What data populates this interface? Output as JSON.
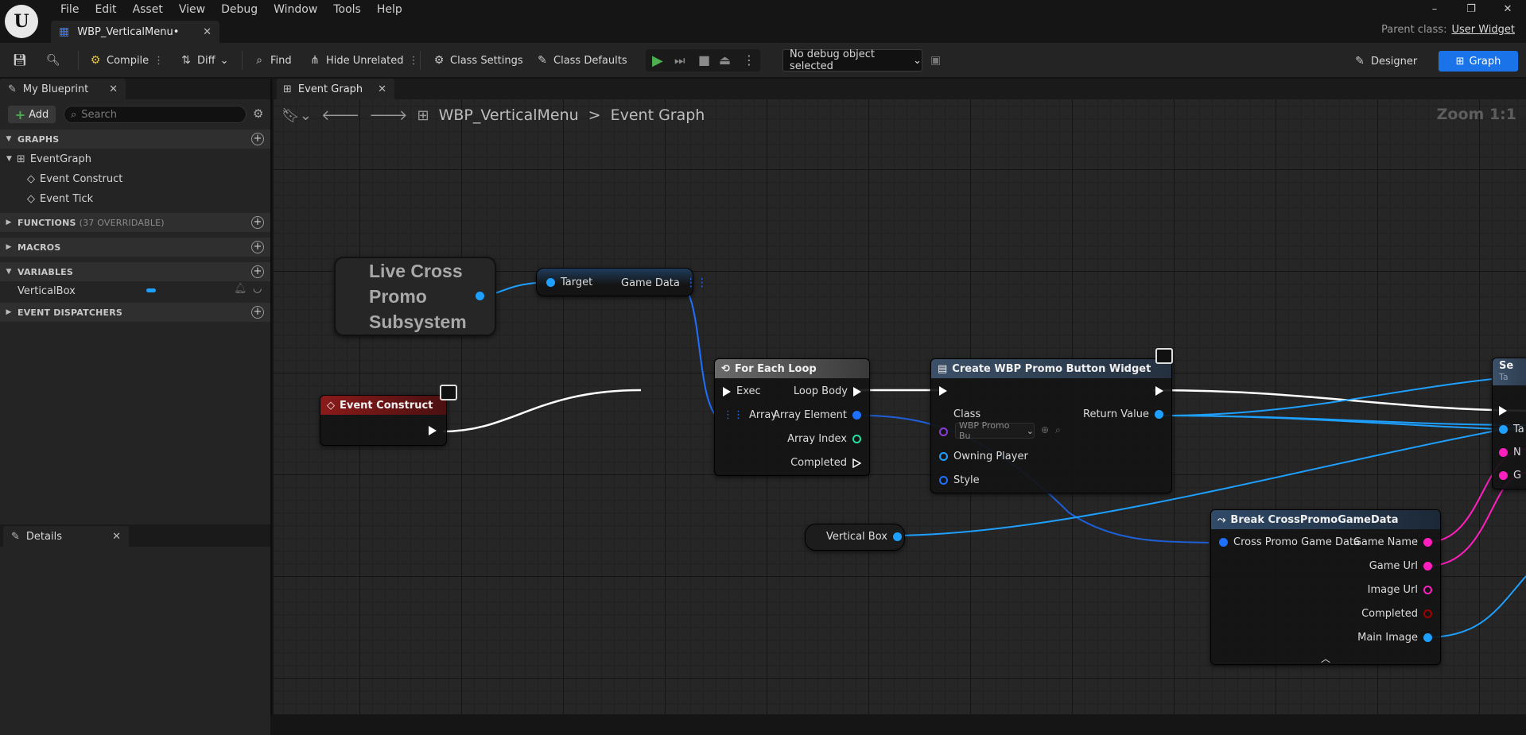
{
  "titlebar": {
    "logo": "U",
    "menu": [
      "File",
      "Edit",
      "Asset",
      "View",
      "Debug",
      "Window",
      "Tools",
      "Help"
    ],
    "document_tab": "WBP_VerticalMenu•",
    "parent_class_label": "Parent class:",
    "parent_class_value": "User Widget",
    "window_controls": [
      "–",
      "❐",
      "✕"
    ]
  },
  "toolbar": {
    "compile": "Compile",
    "diff": "Diff",
    "find": "Find",
    "hide_unrelated": "Hide Unrelated",
    "class_settings": "Class Settings",
    "class_defaults": "Class Defaults",
    "debug_object": "No debug object selected",
    "designer": "Designer",
    "graph": "Graph"
  },
  "my_blueprint": {
    "tab_label": "My Blueprint",
    "add_label": "Add",
    "search_placeholder": "Search",
    "sections": {
      "graphs": "GRAPHS",
      "functions": "FUNCTIONS",
      "functions_sub": "(37 OVERRIDABLE)",
      "macros": "MACROS",
      "variables": "VARIABLES",
      "event_dispatchers": "EVENT DISPATCHERS"
    },
    "graph_items": [
      "EventGraph",
      "Event Construct",
      "Event Tick"
    ],
    "variable_items": [
      "VerticalBox"
    ],
    "variable_color": "#1ea0ff"
  },
  "details": {
    "tab_label": "Details"
  },
  "graph": {
    "tab_label": "Event Graph",
    "breadcrumb_root": "WBP_VerticalMenu",
    "breadcrumb_sep": ">",
    "breadcrumb_leaf": "Event Graph",
    "zoom": "Zoom 1:1"
  },
  "nodes": {
    "subsystem": {
      "title": "Live Cross Promo Subsystem"
    },
    "get_game_data": {
      "in_pin": "Target",
      "out_pin": "Game Data"
    },
    "event_construct": {
      "title": "Event Construct",
      "color": "#8b1a1a"
    },
    "for_each": {
      "title": "For Each Loop",
      "inputs": [
        "Exec",
        "Array"
      ],
      "outputs": [
        "Loop Body",
        "Array Element",
        "Array Index",
        "Completed"
      ]
    },
    "create_widget": {
      "title": "Create WBP Promo Button Widget",
      "class_label": "Class",
      "class_value": "WBP Promo Bu",
      "owning_player": "Owning Player",
      "style": "Style",
      "return_value": "Return Value"
    },
    "vertical_box": {
      "label": "Vertical Box"
    },
    "break_data": {
      "title": "Break CrossPromoGameData",
      "input": "Cross Promo Game Data",
      "outputs": [
        "Game Name",
        "Game Url",
        "Image Url",
        "Completed",
        "Main Image"
      ]
    },
    "cut_node": {
      "title": "Se",
      "subtitle": "Ta",
      "pins": [
        "Ta",
        "N",
        "G"
      ]
    }
  },
  "colors": {
    "accent_blue": "#1a73e8",
    "object_pin": "#1ea0ff",
    "string_pin": "#ff1fbf",
    "int_pin": "#22e3a0",
    "bool_pin": "#a50000",
    "class_pin": "#8a3cd6",
    "play_green": "#4caf50"
  }
}
